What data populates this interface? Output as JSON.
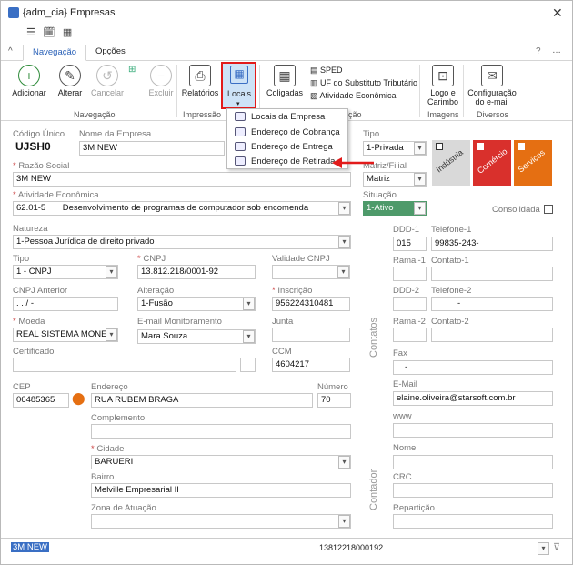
{
  "window": {
    "title": "{adm_cia} Empresas",
    "close": "✕"
  },
  "quick_access": [
    "☰",
    "🗓",
    "▦"
  ],
  "tabs": [
    {
      "label": "Navegação"
    },
    {
      "label": "Opções"
    }
  ],
  "ribbon": {
    "adicionar": "Adicionar",
    "alterar": "Alterar",
    "cancelar": "Cancelar",
    "excluir": "Excluir",
    "relatorios": "Relatórios",
    "locais": "Locais",
    "coligadas": "Coligadas",
    "sped": "SPED",
    "uf_sub": "UF do Substituto Tributário",
    "atividade": "Atividade Econômica",
    "logo": "Logo e",
    "carimbo": "Carimbo",
    "config1": "Configuração",
    "config2": "do e-mail",
    "grp_nav": "Navegação",
    "grp_imp": "Impressão",
    "grp_cao": "ção",
    "grp_img": "Imagens",
    "grp_div": "Diversos",
    "help": "?",
    "more": "…"
  },
  "menu": [
    "Locais da Empresa",
    "Endereço de Cobrança",
    "Endereço de Entrega",
    "Endereço de Retirada"
  ],
  "form": {
    "codigo_label": "Código Único",
    "codigo": "UJSH0",
    "nome_label": "Nome da Empresa",
    "nome": "3M NEW",
    "razao_label": "Razão Social",
    "razao": "3M NEW",
    "ativ_label": "Atividade Econômica",
    "ativ_code": "62.01-5",
    "ativ_desc": "Desenvolvimento de programas de computador sob encomenda",
    "tipo_label": "Tipo",
    "tipo": "1-Privada",
    "matriz_label": "Matriz/Filial",
    "matriz": "Matriz",
    "situacao_label": "Situação",
    "situacao": "1-Ativo",
    "consolidada_label": "Consolidada",
    "tiles": [
      {
        "label": "Indústria",
        "color": "#d9d9d9"
      },
      {
        "label": "Comércio",
        "color": "#d9302c"
      },
      {
        "label": "Serviços",
        "color": "#e56f12"
      }
    ],
    "natureza_label": "Natureza",
    "natureza": "1-Pessoa Jurídica de direito privado",
    "tipo2_label": "Tipo",
    "tipo2": "1 - CNPJ",
    "cnpj_label": "CNPJ",
    "cnpj": "13.812.218/0001-92",
    "validade_label": "Validade CNPJ",
    "cnpj_ant_label": "CNPJ Anterior",
    "cnpj_ant": " .  .  /  -",
    "alteracao_label": "Alteração",
    "alteracao": "1-Fusão",
    "inscricao_label": "Inscrição",
    "inscricao": "956224310481",
    "moeda_label": "Moeda",
    "moeda": "REAL  SISTEMA MONETA",
    "email_mon_label": "E-mail Monitoramento",
    "email_mon": "Mara Souza",
    "junta_label": "Junta",
    "certificado_label": "Certificado",
    "ccm_label": "CCM",
    "ccm": "4604217",
    "cep_label": "CEP",
    "cep": "06485365",
    "endereco_label": "Endereço",
    "endereco": "RUA RUBEM BRAGA",
    "numero_label": "Número",
    "numero": "70",
    "complemento_label": "Complemento",
    "cidade_label": "Cidade",
    "cidade": "BARUERI",
    "bairro_label": "Bairro",
    "bairro": "Melville Empresarial II",
    "zona_label": "Zona de Atuação",
    "contatos_label": "Contatos",
    "ddd1_label": "DDD-1",
    "ddd1": "015",
    "tel1_label": "Telefone-1",
    "tel1": "99835-243-",
    "ramal1_label": "Ramal-1",
    "contato1_label": "Contato-1",
    "ddd2_label": "DDD-2",
    "tel2_label": "Telefone-2",
    "tel2": "-",
    "ramal2_label": "Ramal-2",
    "contato2_label": "Contato-2",
    "fax_label": "Fax",
    "fax": "-",
    "email_label": "E-Mail",
    "email": "elaine.oliveira@starsoft.com.br",
    "www_label": "www",
    "contador_label": "Contador",
    "nome_cont_label": "Nome",
    "crc_label": "CRC",
    "reparticao_label": "Repartição"
  },
  "status": {
    "left": "3M NEW",
    "center": "13812218000192"
  }
}
